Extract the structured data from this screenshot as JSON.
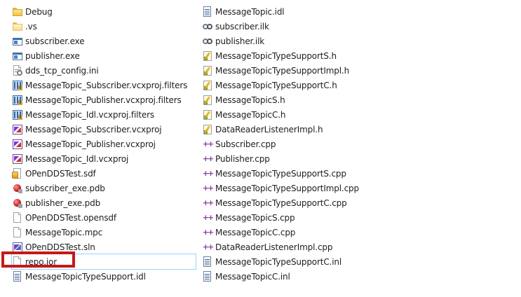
{
  "files_left": [
    {
      "name": "Debug",
      "icon": "folder-icon"
    },
    {
      "name": ".vs",
      "icon": "folder-icon"
    },
    {
      "name": "subscriber.exe",
      "icon": "exe-icon"
    },
    {
      "name": "publisher.exe",
      "icon": "exe-icon"
    },
    {
      "name": "dds_tcp_config.ini",
      "icon": "ini-icon"
    },
    {
      "name": "MessageTopic_Subscriber.vcxproj.filters",
      "icon": "vcxproj-filters-icon"
    },
    {
      "name": "MessageTopic_Publisher.vcxproj.filters",
      "icon": "vcxproj-filters-icon"
    },
    {
      "name": "MessageTopic_Idl.vcxproj.filters",
      "icon": "vcxproj-filters-icon"
    },
    {
      "name": "MessageTopic_Subscriber.vcxproj",
      "icon": "vcxproj-icon"
    },
    {
      "name": "MessageTopic_Publisher.vcxproj",
      "icon": "vcxproj-icon"
    },
    {
      "name": "MessageTopic_Idl.vcxproj",
      "icon": "vcxproj-icon"
    },
    {
      "name": "OPenDDSTest.sdf",
      "icon": "sdf-icon"
    },
    {
      "name": "subscriber_exe.pdb",
      "icon": "pdb-icon"
    },
    {
      "name": "publisher_exe.pdb",
      "icon": "pdb-icon"
    },
    {
      "name": "OPenDDSTest.opensdf",
      "icon": "file-icon"
    },
    {
      "name": "MessageTopic.mpc",
      "icon": "file-icon"
    },
    {
      "name": "OPenDDSTest.sln",
      "icon": "sln-icon"
    },
    {
      "name": "repo.ior",
      "icon": "file-icon"
    },
    {
      "name": "MessageTopicTypeSupport.idl",
      "icon": "idl-icon"
    }
  ],
  "files_right": [
    {
      "name": "MessageTopic.idl",
      "icon": "idl-icon"
    },
    {
      "name": "subscriber.ilk",
      "icon": "ilk-icon"
    },
    {
      "name": "publisher.ilk",
      "icon": "ilk-icon"
    },
    {
      "name": "MessageTopicTypeSupportS.h",
      "icon": "header-icon"
    },
    {
      "name": "MessageTopicTypeSupportImpl.h",
      "icon": "header-icon"
    },
    {
      "name": "MessageTopicTypeSupportC.h",
      "icon": "header-icon"
    },
    {
      "name": "MessageTopicS.h",
      "icon": "header-icon"
    },
    {
      "name": "MessageTopicC.h",
      "icon": "header-icon"
    },
    {
      "name": "DataReaderListenerImpl.h",
      "icon": "header-icon"
    },
    {
      "name": "Subscriber.cpp",
      "icon": "cpp-icon"
    },
    {
      "name": "Publisher.cpp",
      "icon": "cpp-icon"
    },
    {
      "name": "MessageTopicTypeSupportS.cpp",
      "icon": "cpp-icon"
    },
    {
      "name": "MessageTopicTypeSupportImpl.cpp",
      "icon": "cpp-icon"
    },
    {
      "name": "MessageTopicTypeSupportC.cpp",
      "icon": "cpp-icon"
    },
    {
      "name": "MessageTopicS.cpp",
      "icon": "cpp-icon"
    },
    {
      "name": "MessageTopicC.cpp",
      "icon": "cpp-icon"
    },
    {
      "name": "DataReaderListenerImpl.cpp",
      "icon": "cpp-icon"
    },
    {
      "name": "MessageTopicTypeSupportC.inl",
      "icon": "idl-icon"
    },
    {
      "name": "MessageTopicC.inl",
      "icon": "idl-icon"
    }
  ],
  "selected_file": "repo.ior",
  "colors": {
    "highlight_box": "#c41a1a",
    "selection_border": "#99d1ff",
    "cpp_icon": "#8a3da8"
  }
}
